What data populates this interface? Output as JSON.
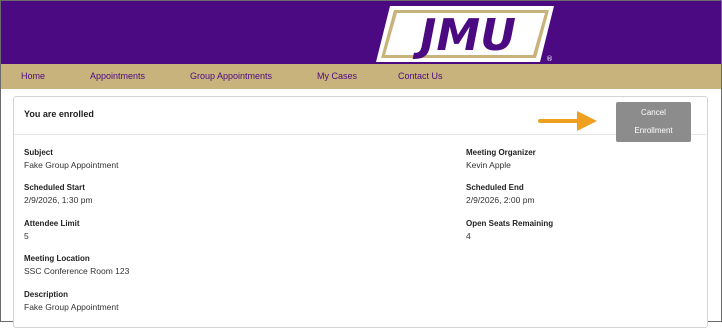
{
  "header": {
    "logo_text": "JMU",
    "brand_colors": {
      "purple": "#4b0a82",
      "gold": "#c9b37c"
    }
  },
  "nav": {
    "items": [
      "Home",
      "Appointments",
      "Group Appointments",
      "My Cases",
      "Contact Us"
    ]
  },
  "main": {
    "title": "You are enrolled",
    "cancel_button": {
      "line1": "Cancel",
      "line2": "Enrollment"
    },
    "fields": {
      "subject": {
        "label": "Subject",
        "value": "Fake Group Appointment"
      },
      "meeting_organizer": {
        "label": "Meeting Organizer",
        "value": "Kevin Apple"
      },
      "scheduled_start": {
        "label": "Scheduled Start",
        "value": "2/9/2026, 1:30 pm"
      },
      "scheduled_end": {
        "label": "Scheduled End",
        "value": "2/9/2026, 2:00 pm"
      },
      "attendee_limit": {
        "label": "Attendee Limit",
        "value": "5"
      },
      "open_seats": {
        "label": "Open Seats Remaining",
        "value": "4"
      },
      "meeting_location": {
        "label": "Meeting Location",
        "value": "SSC Conference Room 123"
      },
      "description": {
        "label": "Description",
        "value": "Fake Group Appointment"
      }
    }
  },
  "annotation": {
    "arrow_color": "#f0a020"
  }
}
